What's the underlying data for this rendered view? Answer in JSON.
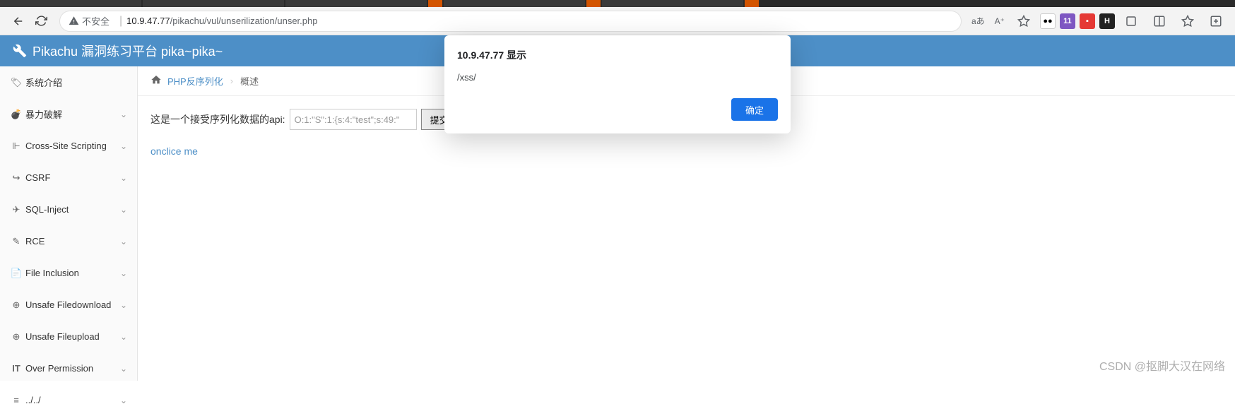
{
  "browser": {
    "insecure_label": "不安全",
    "url_host": "10.9.47.77",
    "url_path": "/pikachu/vul/unserilization/unser.php",
    "lang_indicator": "aあ",
    "reader_indicator": "A⁺",
    "ext_badge": "11",
    "ext_h": "H"
  },
  "header": {
    "title": "Pikachu 漏洞练习平台 pika~pika~"
  },
  "sidebar": {
    "items": [
      {
        "icon": "tag",
        "label": "系统介绍",
        "expandable": false
      },
      {
        "icon": "bomb",
        "label": "暴力破解",
        "expandable": true
      },
      {
        "icon": "sitemap",
        "label": "Cross-Site Scripting",
        "expandable": true
      },
      {
        "icon": "link",
        "label": "CSRF",
        "expandable": true
      },
      {
        "icon": "plane",
        "label": "SQL-Inject",
        "expandable": true
      },
      {
        "icon": "pencil",
        "label": "RCE",
        "expandable": true
      },
      {
        "icon": "file",
        "label": "File Inclusion",
        "expandable": true
      },
      {
        "icon": "download",
        "label": "Unsafe Filedownload",
        "expandable": true
      },
      {
        "icon": "upload",
        "label": "Unsafe Fileupload",
        "expandable": true
      },
      {
        "icon": "it",
        "label": "Over Permission",
        "expandable": true
      },
      {
        "icon": "list",
        "label": "../../",
        "expandable": true
      }
    ]
  },
  "breadcrumb": {
    "link": "PHP反序列化",
    "current": "概述"
  },
  "content": {
    "api_label": "这是一个接受序列化数据的api:",
    "input_value": "O:1:\"S\":1:{s:4:\"test\";s:49:\"",
    "submit_label": "提交",
    "link_text": "onclice me"
  },
  "dialog": {
    "title": "10.9.47.77 显示",
    "body": "/xss/",
    "ok": "确定"
  },
  "watermark": "CSDN @抠脚大汉在网络"
}
